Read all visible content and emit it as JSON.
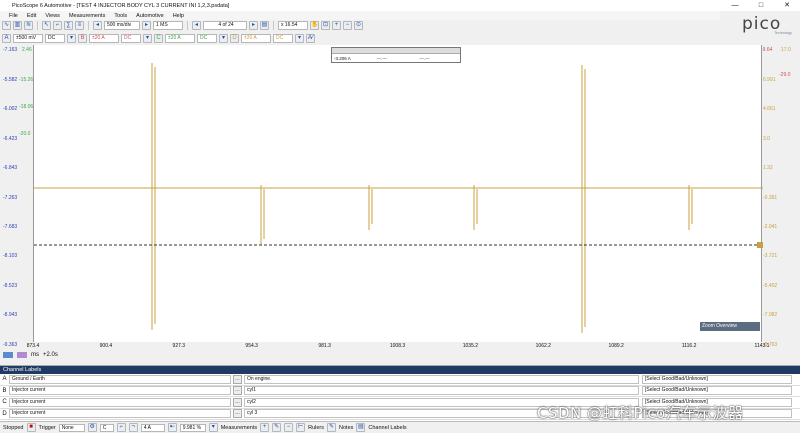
{
  "window": {
    "title": "PicoScope 6 Automotive - [TEST 4 INJECTOR BODY CYL 3 CURRENT INI 1,2,3.psdata]",
    "controls": [
      "—",
      "□",
      "✕"
    ]
  },
  "menu": [
    "File",
    "Edit",
    "Views",
    "Measurements",
    "Tools",
    "Automotive",
    "Help"
  ],
  "toolbar1": {
    "timebase": "500 ms/div",
    "samples": "1 MS",
    "buffer": "4 of 24",
    "zoom": "x 16.54"
  },
  "toolbar2": {
    "chA_range": "±500 mV",
    "chA_coupling": "DC",
    "chB_range": "±20 A",
    "chB_coupling": "DC",
    "chC_range": "±20 A",
    "chC_coupling": "DC",
    "chD_range": "±20 A",
    "chD_coupling": "DC"
  },
  "logo": {
    "text": "pico",
    "sub": "Technology"
  },
  "axes": {
    "left_top_a": "-7.163",
    "left_top_b": "2.46",
    "left_a_ticks": [
      "-5.582",
      "-6.002",
      "-6.423",
      "-6.843",
      "-7.263",
      "-7.683",
      "-8.103",
      "-8.523",
      "-8.943",
      "-9.363"
    ],
    "left_b_ticks": [
      "-15.26",
      "-18.06",
      "-20.0"
    ],
    "right_top_a": "-9.64",
    "right_top_b": "17.0",
    "right_ticks": [
      "6.991",
      "4.661",
      "3.0",
      "1.32",
      "-0.361",
      "-2.041",
      "-3.721",
      "-5.402",
      "-7.082",
      "-8.763"
    ],
    "right_extra": "-29.0"
  },
  "xaxis": {
    "ticks": [
      "873.4",
      "900.4",
      "927.3",
      "954.3",
      "981.3",
      "1008.3",
      "1035.2",
      "1062.2",
      "1089.2",
      "1116.2",
      "1143.1"
    ],
    "unit": "ms",
    "offset": "+2.0s"
  },
  "ruler_box": {
    "headers": [
      "",
      "",
      ""
    ],
    "value_a": "-3.206 A",
    "value_b": "---.---",
    "value_c": "---.---"
  },
  "zoom_overview": "Zoom Overview",
  "channel_labels": {
    "title": "Channel Labels",
    "rows": [
      {
        "letter": "A",
        "probe": "Ground / Earth",
        "note": "On engine.",
        "status": "[Select Good/Bad/Unknown]"
      },
      {
        "letter": "B",
        "probe": "Injector current",
        "note": "cyl1",
        "status": "[Select Good/Bad/Unknown]"
      },
      {
        "letter": "C",
        "probe": "Injector current",
        "note": "cyl2",
        "status": "[Select Good/Bad/Unknown]"
      },
      {
        "letter": "D",
        "probe": "Injector current",
        "note": "cyl 3",
        "status": "[Select Good/Bad/Unknown]"
      }
    ]
  },
  "status": {
    "state": "Stopped",
    "trigger_label": "Trigger",
    "trigger_mode": "None",
    "trigger_channel": "C",
    "level": "4 A",
    "percent": "9.981 %",
    "measurements": "Measurements",
    "rulers": "Rulers",
    "notes": "Notes",
    "channel_labels": "Channel Labels"
  },
  "watermark": "CSDN @虹科Pico汽车示波器",
  "colors": {
    "trace": "#c8a040",
    "chA": "#2d3fb5",
    "chB": "#d05050",
    "chC": "#3aa84a",
    "chD": "#c8a040"
  }
}
